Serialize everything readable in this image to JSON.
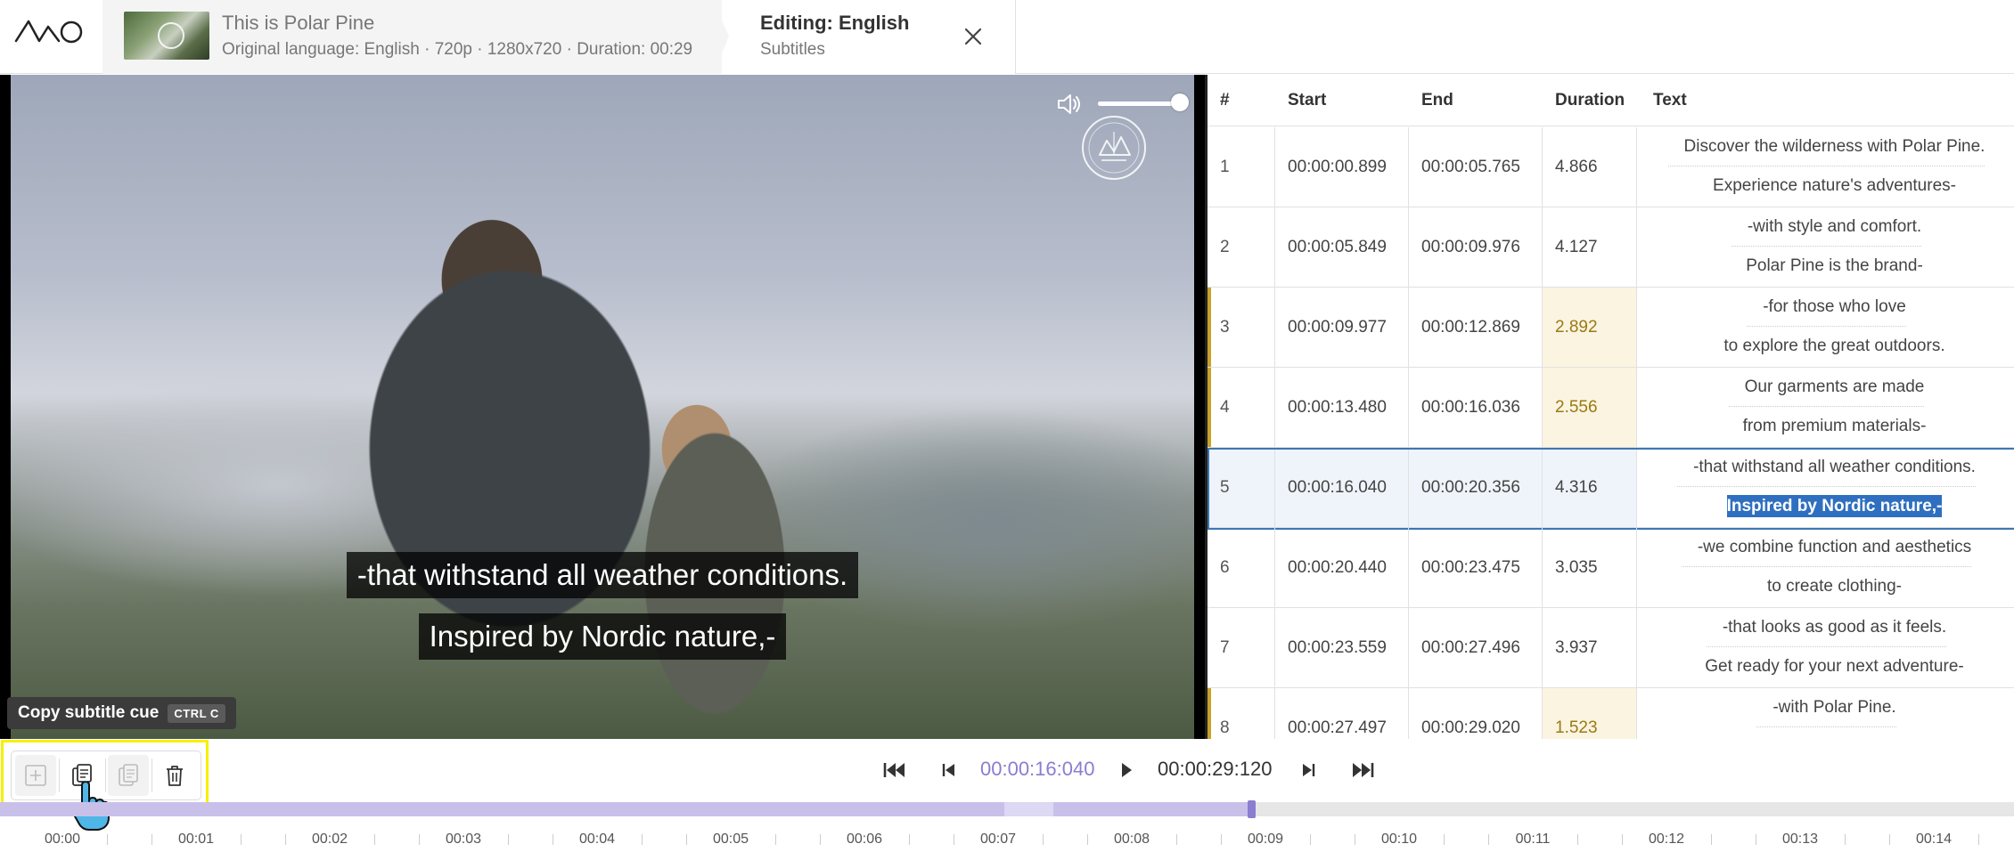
{
  "header": {
    "video_title": "This is Polar Pine",
    "video_meta": "Original language: English · 720p · 1280x720 · Duration: 00:29",
    "editing_title": "Editing: English",
    "editing_sub": "Subtitles"
  },
  "player": {
    "caption_line1": "-that withstand all weather conditions.",
    "caption_line2": "Inspired by Nordic nature,-",
    "volume_level": 1.0
  },
  "tooltip": {
    "label": "Copy subtitle cue",
    "shortcut": "CTRL C"
  },
  "table": {
    "headers": {
      "num": "#",
      "start": "Start",
      "end": "End",
      "duration": "Duration",
      "text": "Text"
    },
    "rows": [
      {
        "num": "1",
        "start": "00:00:00.899",
        "end": "00:00:05.765",
        "duration": "4.866",
        "line1": "Discover the wilderness with Polar Pine.",
        "line2": "Experience nature's adventures-",
        "warn": false,
        "active": false
      },
      {
        "num": "2",
        "start": "00:00:05.849",
        "end": "00:00:09.976",
        "duration": "4.127",
        "line1": "-with style and comfort.",
        "line2": "Polar Pine is the brand-",
        "warn": false,
        "active": false
      },
      {
        "num": "3",
        "start": "00:00:09.977",
        "end": "00:00:12.869",
        "duration": "2.892",
        "line1": "-for those who love",
        "line2": "to explore the great outdoors.",
        "warn": true,
        "active": false
      },
      {
        "num": "4",
        "start": "00:00:13.480",
        "end": "00:00:16.036",
        "duration": "2.556",
        "line1": "Our garments are made",
        "line2": "from premium materials-",
        "warn": true,
        "active": false
      },
      {
        "num": "5",
        "start": "00:00:16.040",
        "end": "00:00:20.356",
        "duration": "4.316",
        "line1": "-that withstand all weather conditions.",
        "line2": "Inspired by Nordic nature,-",
        "warn": false,
        "active": true
      },
      {
        "num": "6",
        "start": "00:00:20.440",
        "end": "00:00:23.475",
        "duration": "3.035",
        "line1": "-we combine function and aesthetics",
        "line2": "to create clothing-",
        "warn": false,
        "active": false
      },
      {
        "num": "7",
        "start": "00:00:23.559",
        "end": "00:00:27.496",
        "duration": "3.937",
        "line1": "-that looks as good as it feels.",
        "line2": "Get ready for your next adventure-",
        "warn": false,
        "active": false
      },
      {
        "num": "8",
        "start": "00:00:27.497",
        "end": "00:00:29.020",
        "duration": "1.523",
        "line1": "-with Polar Pine.",
        "line2": "",
        "warn": true,
        "active": false
      }
    ]
  },
  "transport": {
    "current_time": "00:00:16:040",
    "total_time": "00:00:29:120"
  },
  "timeline": {
    "ticks": [
      "00:00",
      "00:01",
      "00:02",
      "00:03",
      "00:04",
      "00:05",
      "00:06",
      "00:07",
      "00:08",
      "00:09",
      "00:10",
      "00:11",
      "00:12",
      "00:13",
      "00:14"
    ],
    "playhead_fraction": 0.551
  },
  "icons": {
    "logo": "vimeo-style-logo",
    "close": "close-icon",
    "volume": "volume-icon",
    "add": "add-cue-icon",
    "copy": "copy-cue-icon",
    "paste": "paste-cue-icon",
    "delete": "trash-icon"
  },
  "colors": {
    "accent": "#8b7dd0",
    "highlight": "#f6f000",
    "warning": "#c9a227",
    "selection": "#2f6fbf"
  }
}
